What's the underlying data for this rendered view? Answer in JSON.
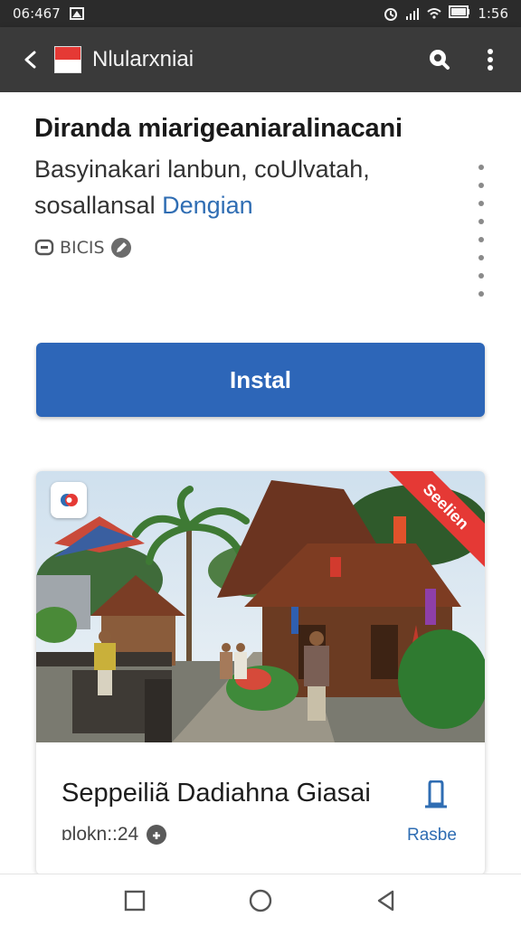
{
  "status_bar": {
    "time": "06:467",
    "clock_right": "1:56",
    "icons": [
      "alarm-icon",
      "signal-icon",
      "wifi-icon",
      "battery-icon"
    ]
  },
  "app_bar": {
    "title": "Nlularxniai",
    "icons": [
      "back-icon",
      "flag-icon",
      "search-icon",
      "more-vert-icon"
    ]
  },
  "app_info": {
    "name": "Diranda miarigeaniaralinacani",
    "description_line1": "Basyinakari lanbun, coUlvatah,",
    "description_line2": "sosallansal",
    "description_link": "Dengian",
    "meta_label": "BICIS",
    "meta_icons": [
      "chat-icon",
      "edit-badge-icon"
    ]
  },
  "install_button": {
    "label": "Instal"
  },
  "feature_card": {
    "ribbon": "Seelien",
    "title": "Seppeiliã Dadiahna Giasai",
    "meta": "ɒlokn::24",
    "action": "Rasbe",
    "icons": [
      "app-badge-icon",
      "bookmark-icon",
      "info-icon"
    ]
  },
  "nav_bar": {
    "icons": [
      "recents-icon",
      "home-icon",
      "back-triangle-icon"
    ]
  },
  "colors": {
    "primary": "#2d66b8",
    "app_bar": "#3a3a3a",
    "status_bar": "#2b2b2b",
    "ribbon": "#e53935",
    "link": "#2f6db3"
  }
}
